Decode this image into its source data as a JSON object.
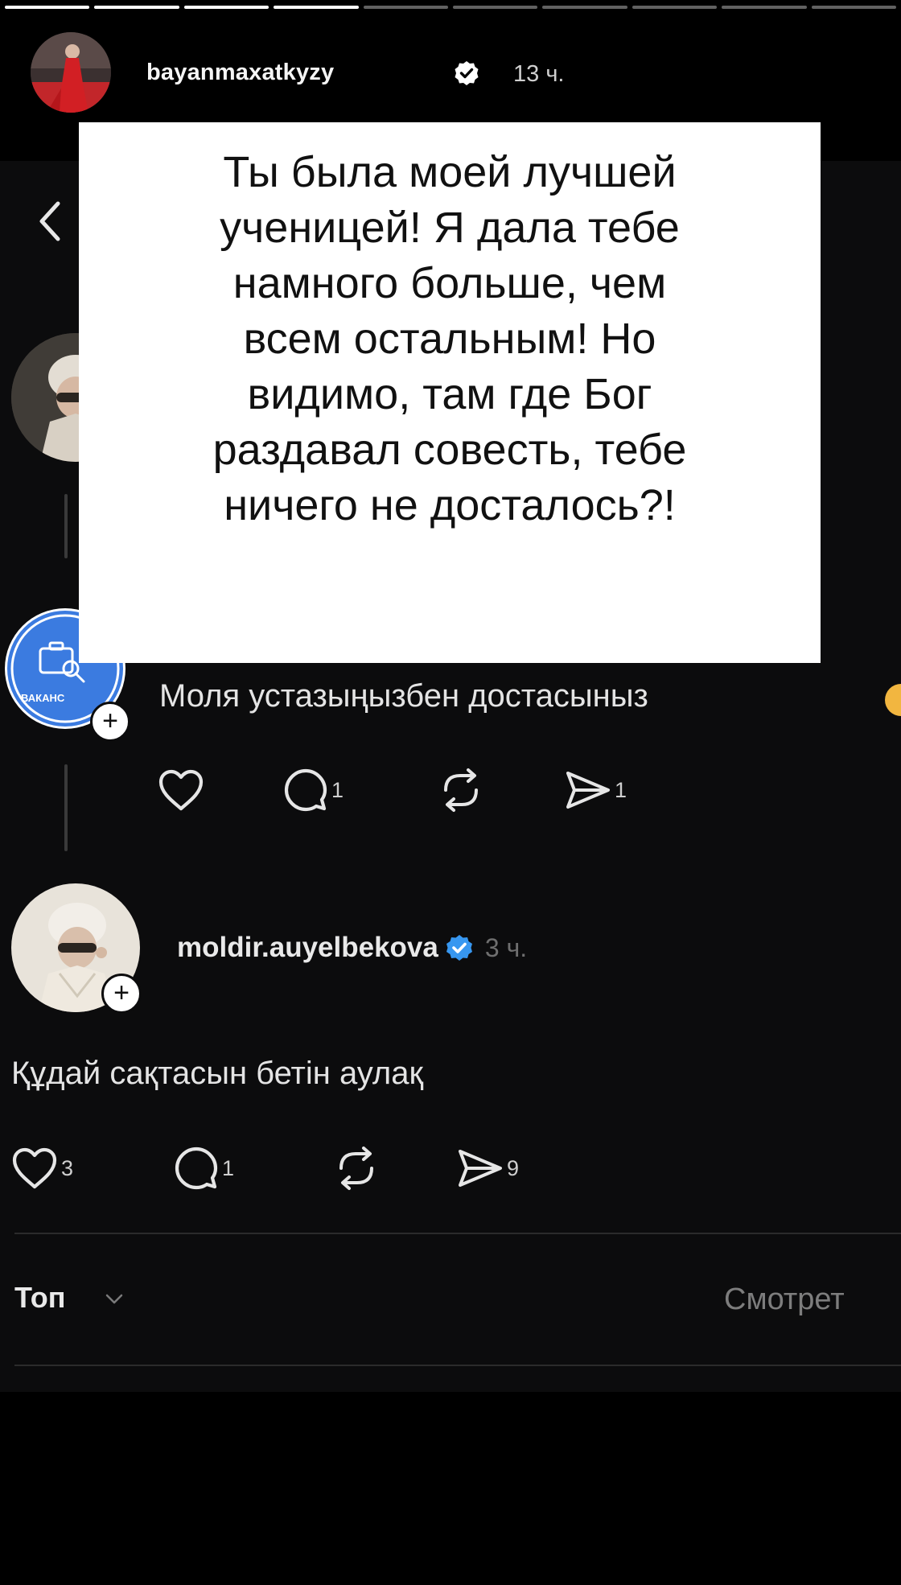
{
  "story": {
    "segments_total": 10,
    "segments_done": 4,
    "username": "bayanmaxatkyzy",
    "time": "13 ч.",
    "quote": [
      "Ты была моей лучшей",
      "ученицей! Я дала тебе",
      "намного больше, чем",
      "всем остальным! Но",
      "видимо, там где Бог",
      "раздавал совесть, тебе",
      "ничего не досталось?!"
    ]
  },
  "thread": {
    "reply1": {
      "avatar_label": "ВАКАНС",
      "text": "Моля устазыңызбен достасыныз",
      "likes": "",
      "comments": "1",
      "reposts": "",
      "shares": "1"
    },
    "reply2": {
      "username": "moldir.auyelbekova",
      "time": "3 ч.",
      "text": "Құдай сақтасын бетін аулақ",
      "likes": "3",
      "comments": "1",
      "reposts": "",
      "shares": "9"
    },
    "footer": {
      "sort_label": "Топ",
      "view_activity": "Смотрет"
    }
  },
  "colors": {
    "background": "#000000",
    "panel": "#0c0c0d",
    "verified": "#3797f0",
    "reply_avatar_blue": "#3b7be0"
  },
  "plus": "+"
}
